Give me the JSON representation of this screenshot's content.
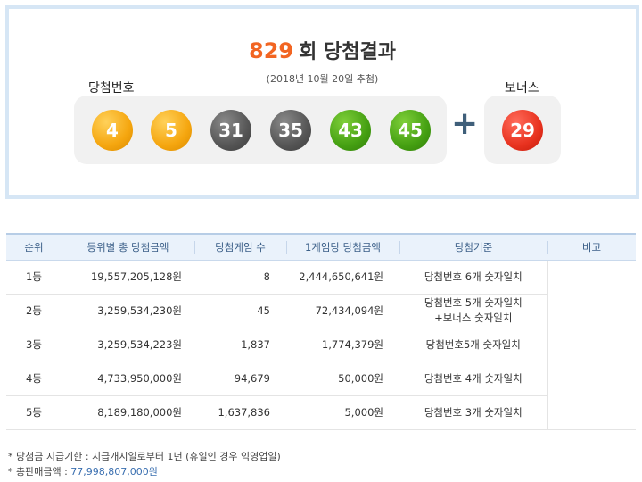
{
  "header": {
    "round_number": "829",
    "title_suffix": "회 당첨결과",
    "draw_date": "(2018년 10월 20일 추첨)",
    "winning_label": "당첨번호",
    "bonus_label": "보너스"
  },
  "winning_numbers": [
    {
      "value": "4",
      "color": "#f5a60f"
    },
    {
      "value": "5",
      "color": "#f5a60f"
    },
    {
      "value": "31",
      "color": "#555555"
    },
    {
      "value": "35",
      "color": "#555555"
    },
    {
      "value": "43",
      "color": "#45a012"
    },
    {
      "value": "45",
      "color": "#45a012"
    }
  ],
  "plus_sign": "+",
  "bonus_number": {
    "value": "29",
    "color": "#e8321f"
  },
  "table": {
    "headers": [
      "순위",
      "등위별 총 당첨금액",
      "당첨게임 수",
      "1게임당 당첨금액",
      "당첨기준",
      "비고"
    ],
    "rows": [
      {
        "rank": "1등",
        "total": "19,557,205,128원",
        "games": "8",
        "per_game": "2,444,650,641원",
        "criteria": [
          "당첨번호 6개 숫자일치"
        ]
      },
      {
        "rank": "2등",
        "total": "3,259,534,230원",
        "games": "45",
        "per_game": "72,434,094원",
        "criteria": [
          "당첨번호 5개 숫자일치",
          "+보너스 숫자일치"
        ]
      },
      {
        "rank": "3등",
        "total": "3,259,534,223원",
        "games": "1,837",
        "per_game": "1,774,379원",
        "criteria": [
          "당첨번호5개 숫자일치"
        ]
      },
      {
        "rank": "4등",
        "total": "4,733,950,000원",
        "games": "94,679",
        "per_game": "50,000원",
        "criteria": [
          "당첨번호 4개 숫자일치"
        ]
      },
      {
        "rank": "5등",
        "total": "8,189,180,000원",
        "games": "1,637,836",
        "per_game": "5,000원",
        "criteria": [
          "당첨번호 3개 숫자일치"
        ]
      }
    ]
  },
  "footnotes": {
    "deadline": "* 당첨금 지급기한 : 지급개시일로부터 1년 (휴일인 경우 익영업일)",
    "sales_label": "* 총판매금액 : ",
    "sales_value": "77,998,807,000원"
  },
  "colors": {
    "accent_orange": "#f26522",
    "border_blue": "#d6e6f5",
    "header_bg": "#eaf2fb",
    "header_text": "#3b5f88"
  }
}
